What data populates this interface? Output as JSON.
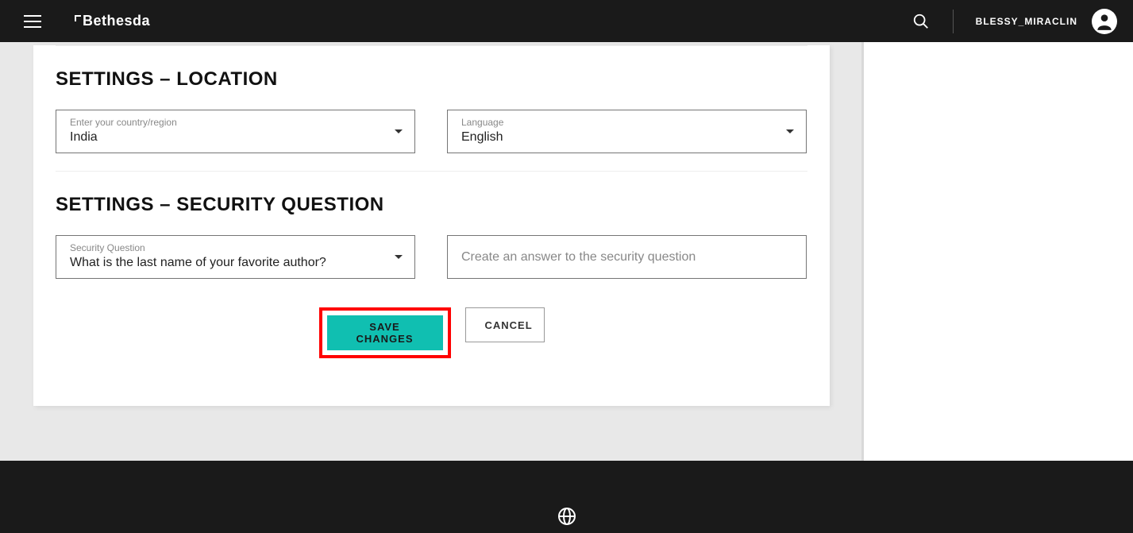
{
  "header": {
    "brand": "Bethesda",
    "username": "BLESSY_MIRACLIN"
  },
  "sections": {
    "location": {
      "title": "SETTINGS – LOCATION",
      "country_label": "Enter your country/region",
      "country_value": "India",
      "language_label": "Language",
      "language_value": "English"
    },
    "security": {
      "title": "SETTINGS – SECURITY QUESTION",
      "question_label": "Security Question",
      "question_value": "What is the last name of your favorite author?",
      "answer_placeholder": "Create an answer to the security question"
    }
  },
  "buttons": {
    "save": "SAVE CHANGES",
    "cancel": "CANCEL"
  }
}
